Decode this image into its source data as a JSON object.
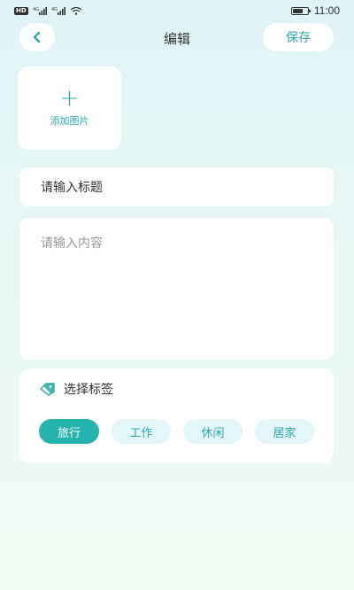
{
  "status_bar": {
    "network_label": "HD",
    "signal_1_label": "4G",
    "signal_2_label": "4G",
    "time": "11:00",
    "battery_level": 0.6
  },
  "header": {
    "title": "编辑",
    "save_label": "保存"
  },
  "image_picker": {
    "plus": "+",
    "label": "添加图片"
  },
  "form": {
    "title_placeholder": "请输入标题",
    "content_placeholder": "请输入内容"
  },
  "tags": {
    "header": "选择标签",
    "items": [
      {
        "label": "旅行",
        "selected": true
      },
      {
        "label": "工作",
        "selected": false
      },
      {
        "label": "休闲",
        "selected": false
      },
      {
        "label": "居家",
        "selected": false
      }
    ]
  },
  "colors": {
    "accent": "#2aa9a6",
    "selected_tag": "#25b3ad",
    "tag_bg": "#e4f6f8"
  }
}
